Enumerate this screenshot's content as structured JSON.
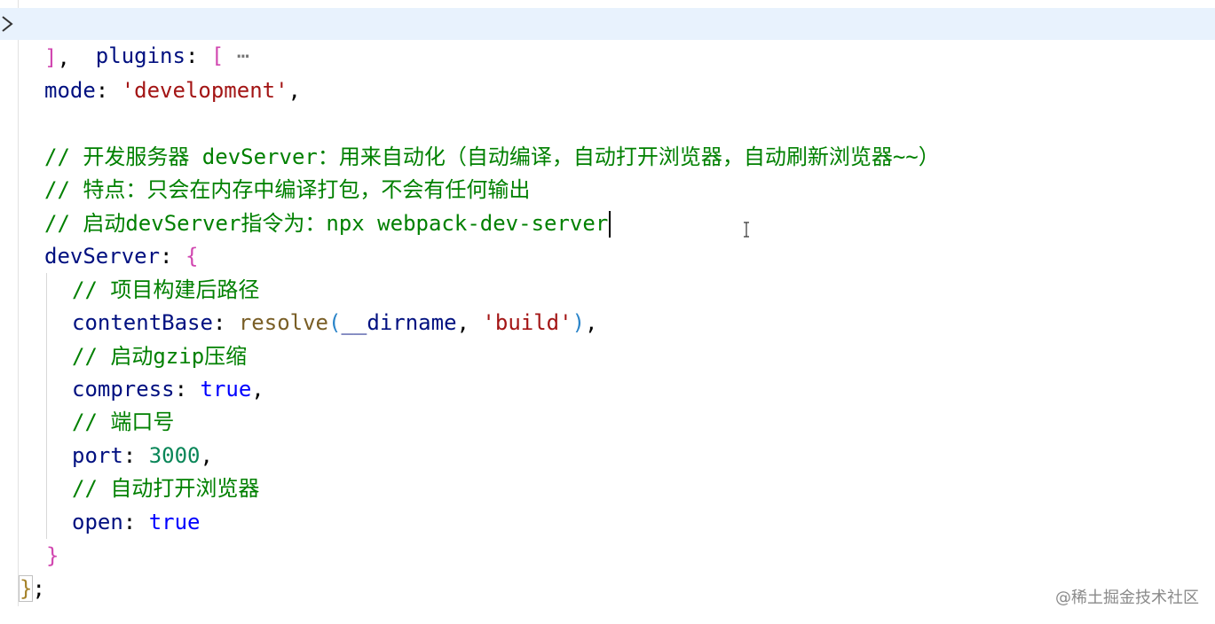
{
  "editor": {
    "lines": {
      "l1": {
        "key": "plugins",
        "colon": ": ",
        "bracket": "[",
        "fold": " ⋯"
      },
      "l2": {
        "bracket": "]",
        "punct": ","
      },
      "l3": {
        "key": "mode",
        "colon": ": ",
        "value": "'development'",
        "punct": ","
      },
      "l4": {
        "comment": "// 开发服务器 devServer：用来自动化（自动编译，自动打开浏览器，自动刷新浏览器~~）"
      },
      "l5": {
        "comment": "// 特点：只会在内存中编译打包，不会有任何输出"
      },
      "l6": {
        "comment": "// 启动devServer指令为：npx webpack-dev-server"
      },
      "l7": {
        "key": "devServer",
        "colon": ": ",
        "bracket": "{"
      },
      "l8": {
        "comment": "// 项目构建后路径"
      },
      "l9": {
        "key": "contentBase",
        "colon": ": ",
        "func": "resolve",
        "open": "(",
        "arg1": "__dirname",
        "comma": ", ",
        "arg2": "'build'",
        "close": ")",
        "punct": ","
      },
      "l10": {
        "comment": "// 启动gzip压缩"
      },
      "l11": {
        "key": "compress",
        "colon": ": ",
        "value": "true",
        "punct": ","
      },
      "l12": {
        "comment": "// 端口号"
      },
      "l13": {
        "key": "port",
        "colon": ": ",
        "value": "3000",
        "punct": ","
      },
      "l14": {
        "comment": "// 自动打开浏览器"
      },
      "l15": {
        "key": "open",
        "colon": ": ",
        "value": "true"
      },
      "l16": {
        "bracket": "}"
      },
      "l17": {
        "bracket": "}",
        "punct": ";"
      }
    },
    "icons": {
      "fold": "chevron-right-icon",
      "cursor": "text-ibeam-icon"
    },
    "colors": {
      "keyword": "#001080",
      "string": "#a31515",
      "comment": "#008000",
      "boolean": "#0000ff",
      "number": "#098658",
      "highlight": "#e8f2fd"
    }
  },
  "watermark": {
    "text": "@稀土掘金技术社区"
  }
}
